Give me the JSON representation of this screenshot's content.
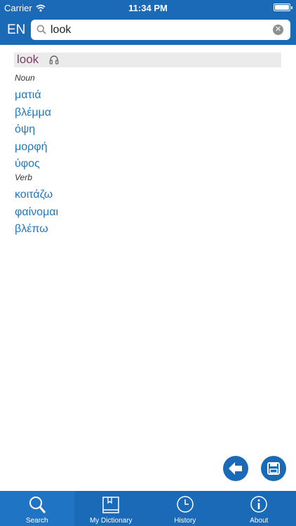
{
  "status": {
    "carrier": "Carrier",
    "time": "11:34 PM"
  },
  "header": {
    "language": "EN"
  },
  "search": {
    "value": "look"
  },
  "entry": {
    "headword": "look",
    "groups": [
      {
        "pos": "Noun",
        "translations": [
          "ματιά",
          "βλέμμα",
          "όψη",
          "μορφή",
          "ύφος"
        ]
      },
      {
        "pos": "Verb",
        "translations": [
          "κοιτάζω",
          "φαίνομαι",
          "βλέπω"
        ]
      }
    ]
  },
  "tabs": [
    {
      "label": "Search",
      "icon": "search-icon"
    },
    {
      "label": "My Dictionary",
      "icon": "book-icon"
    },
    {
      "label": "History",
      "icon": "clock-icon"
    },
    {
      "label": "About",
      "icon": "info-icon"
    }
  ],
  "colors": {
    "brand": "#1a6ab8",
    "translation": "#2176b9",
    "headword": "#7a3f62"
  }
}
